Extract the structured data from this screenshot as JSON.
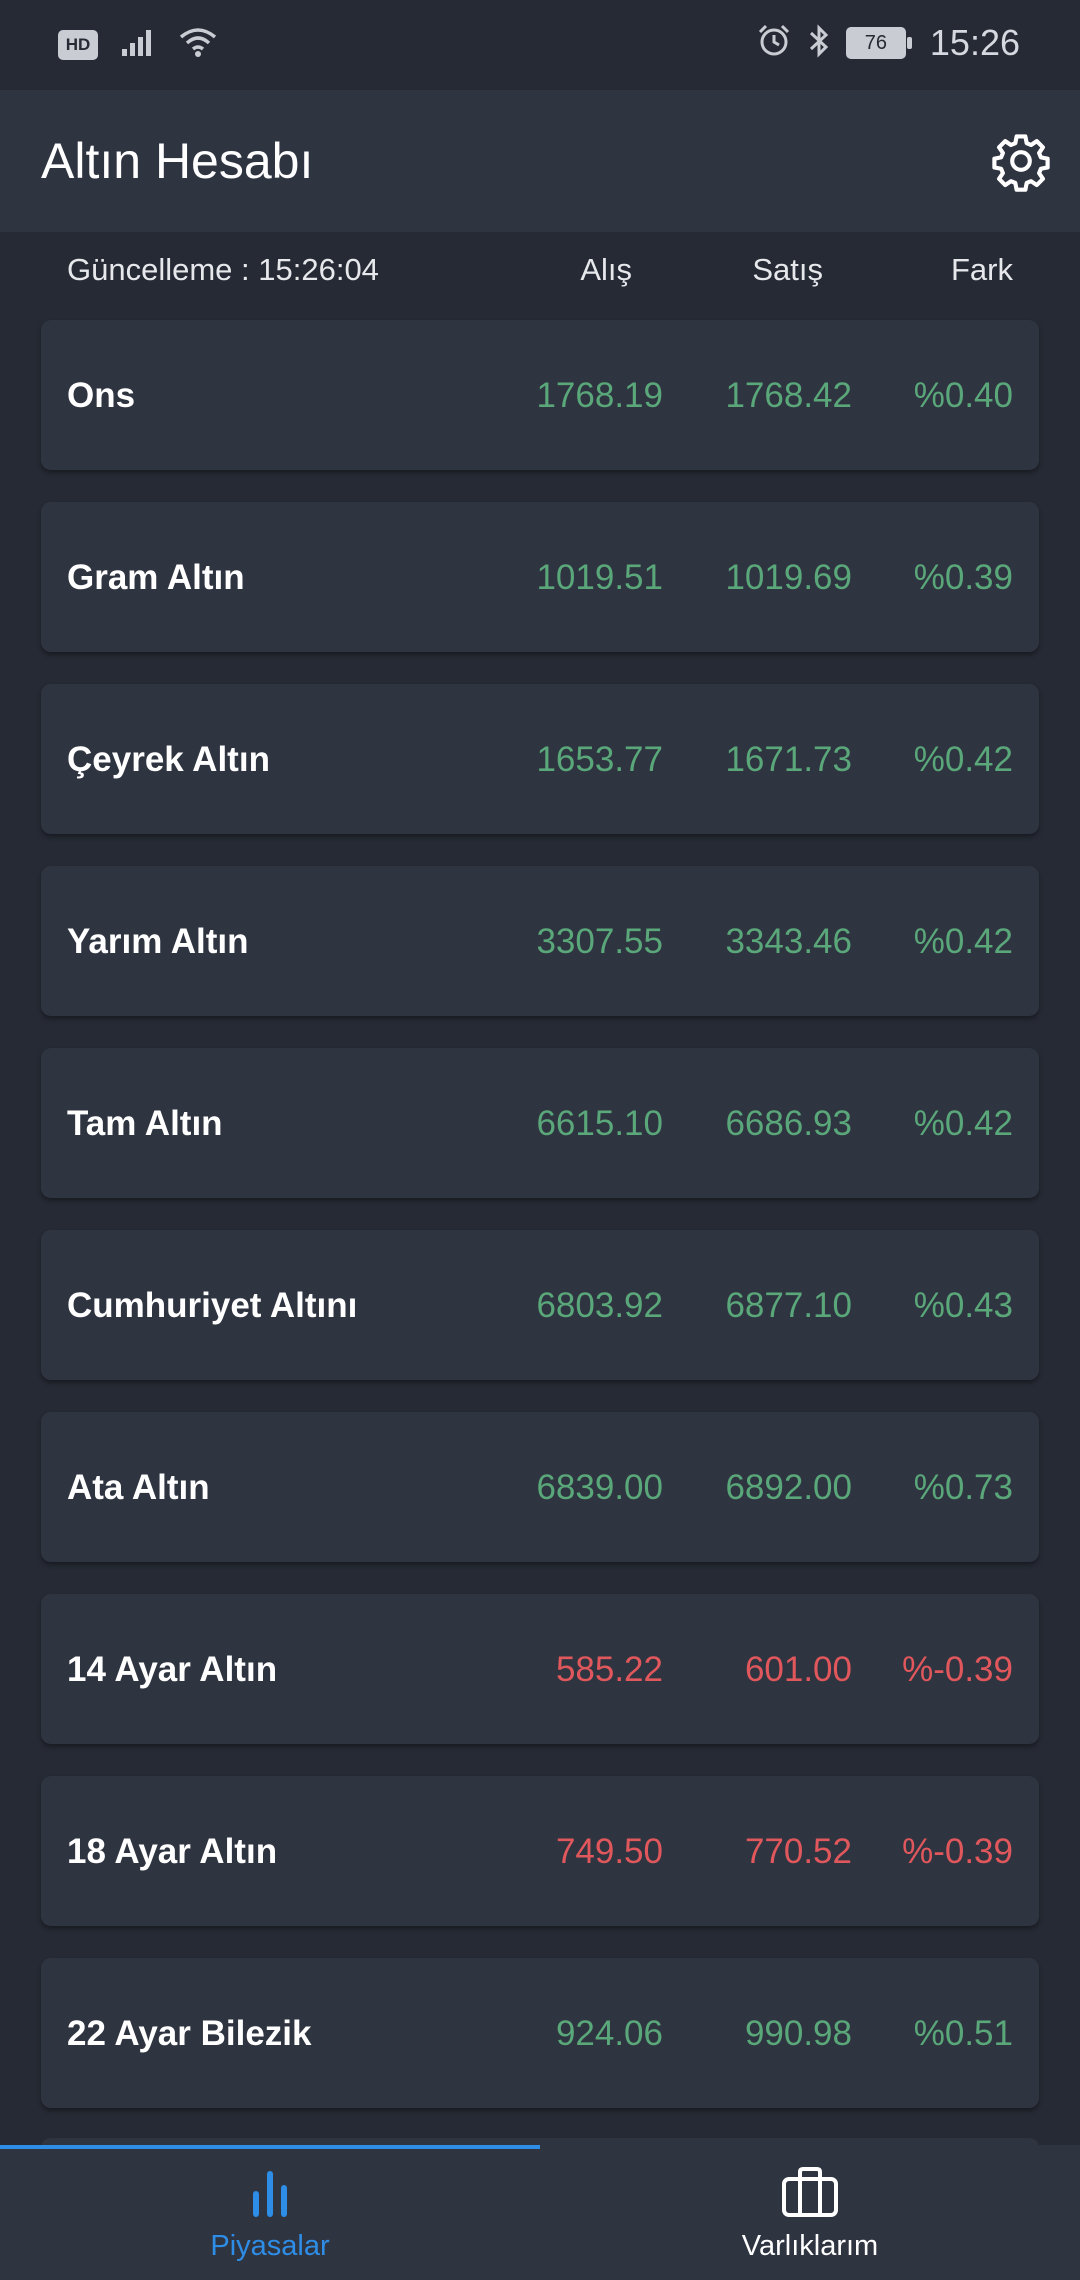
{
  "status_bar": {
    "hd_label": "HD",
    "battery_level": "76",
    "time": "15:26",
    "icons": [
      "hd-icon",
      "signal-icon",
      "wifi-icon",
      "alarm-icon",
      "bluetooth-icon",
      "battery-icon"
    ]
  },
  "app_bar": {
    "title": "Altın Hesabı",
    "settings_icon": "gear-icon"
  },
  "table_header": {
    "update_label": "Güncelleme : 15:26:04",
    "buy_label": "Alış",
    "sell_label": "Satış",
    "diff_label": "Fark"
  },
  "rows": [
    {
      "name": "Ons",
      "buy": "1768.19",
      "sell": "1768.42",
      "diff": "%0.40",
      "trend": "up"
    },
    {
      "name": "Gram Altın",
      "buy": "1019.51",
      "sell": "1019.69",
      "diff": "%0.39",
      "trend": "up"
    },
    {
      "name": "Çeyrek Altın",
      "buy": "1653.77",
      "sell": "1671.73",
      "diff": "%0.42",
      "trend": "up"
    },
    {
      "name": "Yarım Altın",
      "buy": "3307.55",
      "sell": "3343.46",
      "diff": "%0.42",
      "trend": "up"
    },
    {
      "name": "Tam Altın",
      "buy": "6615.10",
      "sell": "6686.93",
      "diff": "%0.42",
      "trend": "up"
    },
    {
      "name": "Cumhuriyet Altını",
      "buy": "6803.92",
      "sell": "6877.10",
      "diff": "%0.43",
      "trend": "up"
    },
    {
      "name": "Ata Altın",
      "buy": "6839.00",
      "sell": "6892.00",
      "diff": "%0.73",
      "trend": "up"
    },
    {
      "name": "14 Ayar Altın",
      "buy": "585.22",
      "sell": "601.00",
      "diff": "%-0.39",
      "trend": "down"
    },
    {
      "name": "18 Ayar Altın",
      "buy": "749.50",
      "sell": "770.52",
      "diff": "%-0.39",
      "trend": "down"
    },
    {
      "name": "22 Ayar Bilezik",
      "buy": "924.06",
      "sell": "990.98",
      "diff": "%0.51",
      "trend": "up"
    }
  ],
  "colors": {
    "up": "#5aa77a",
    "down": "#e0575c",
    "accent": "#2e8de6",
    "background": "#262a34",
    "card": "#2f3441"
  },
  "bottom_nav": {
    "active": "markets",
    "items": [
      {
        "key": "markets",
        "label": "Piyasalar",
        "icon": "bar-chart-icon"
      },
      {
        "key": "assets",
        "label": "Varlıklarım",
        "icon": "briefcase-icon"
      }
    ]
  }
}
